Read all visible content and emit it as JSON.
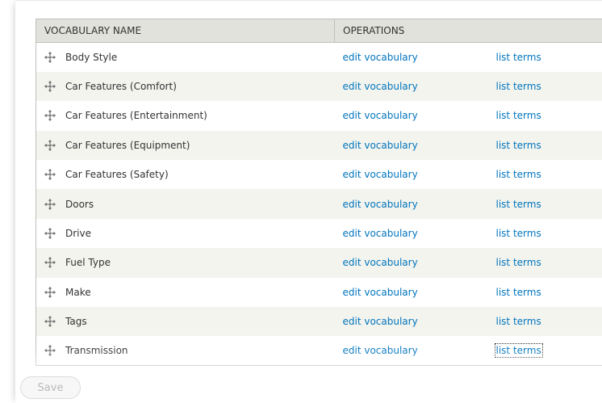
{
  "table": {
    "headers": {
      "name": "VOCABULARY NAME",
      "operations": "OPERATIONS"
    },
    "drag_icon": "move-cross-icon",
    "rows": [
      {
        "name": "Body Style",
        "edit": "edit vocabulary",
        "list": "list terms"
      },
      {
        "name": "Car Features (Comfort)",
        "edit": "edit vocabulary",
        "list": "list terms"
      },
      {
        "name": "Car Features (Entertainment)",
        "edit": "edit vocabulary",
        "list": "list terms"
      },
      {
        "name": "Car Features (Equipment)",
        "edit": "edit vocabulary",
        "list": "list terms"
      },
      {
        "name": "Car Features (Safety)",
        "edit": "edit vocabulary",
        "list": "list terms"
      },
      {
        "name": "Doors",
        "edit": "edit vocabulary",
        "list": "list terms"
      },
      {
        "name": "Drive",
        "edit": "edit vocabulary",
        "list": "list terms"
      },
      {
        "name": "Fuel Type",
        "edit": "edit vocabulary",
        "list": "list terms"
      },
      {
        "name": "Make",
        "edit": "edit vocabulary",
        "list": "list terms"
      },
      {
        "name": "Tags",
        "edit": "edit vocabulary",
        "list": "list terms"
      },
      {
        "name": "Transmission",
        "edit": "edit vocabulary",
        "list": "list terms"
      }
    ]
  },
  "form": {
    "save_label": "Save"
  },
  "colors": {
    "link": "#0074bd",
    "header_bg": "#e1e2dc",
    "stripe_bg": "#f3f4ee"
  }
}
